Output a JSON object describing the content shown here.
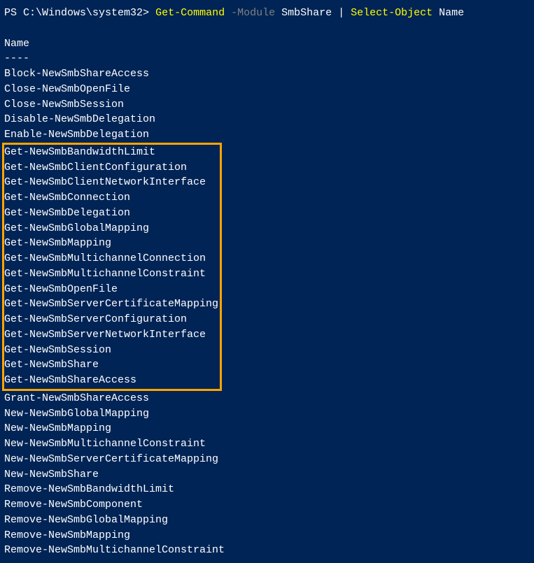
{
  "prompt": {
    "prefix": "PS ",
    "path": "C:\\Windows\\system32",
    "caret": "> ",
    "cmdlet1": "Get-Command",
    "param1": " -Module",
    "arg1": " SmbShare ",
    "pipe": "|",
    "cmdlet2": " Select-Object",
    "arg2": " Name"
  },
  "header": "Name",
  "divider": "----",
  "output_before": [
    "Block-NewSmbShareAccess",
    "Close-NewSmbOpenFile",
    "Close-NewSmbSession",
    "Disable-NewSmbDelegation",
    "Enable-NewSmbDelegation"
  ],
  "output_highlighted": [
    "Get-NewSmbBandwidthLimit",
    "Get-NewSmbClientConfiguration",
    "Get-NewSmbClientNetworkInterface",
    "Get-NewSmbConnection",
    "Get-NewSmbDelegation",
    "Get-NewSmbGlobalMapping",
    "Get-NewSmbMapping",
    "Get-NewSmbMultichannelConnection",
    "Get-NewSmbMultichannelConstraint",
    "Get-NewSmbOpenFile",
    "Get-NewSmbServerCertificateMapping",
    "Get-NewSmbServerConfiguration",
    "Get-NewSmbServerNetworkInterface",
    "Get-NewSmbSession",
    "Get-NewSmbShare",
    "Get-NewSmbShareAccess"
  ],
  "output_after": [
    "Grant-NewSmbShareAccess",
    "New-NewSmbGlobalMapping",
    "New-NewSmbMapping",
    "New-NewSmbMultichannelConstraint",
    "New-NewSmbServerCertificateMapping",
    "New-NewSmbShare",
    "Remove-NewSmbBandwidthLimit",
    "Remove-NewSmbComponent",
    "Remove-NewSmbGlobalMapping",
    "Remove-NewSmbMapping",
    "Remove-NewSmbMultichannelConstraint"
  ]
}
